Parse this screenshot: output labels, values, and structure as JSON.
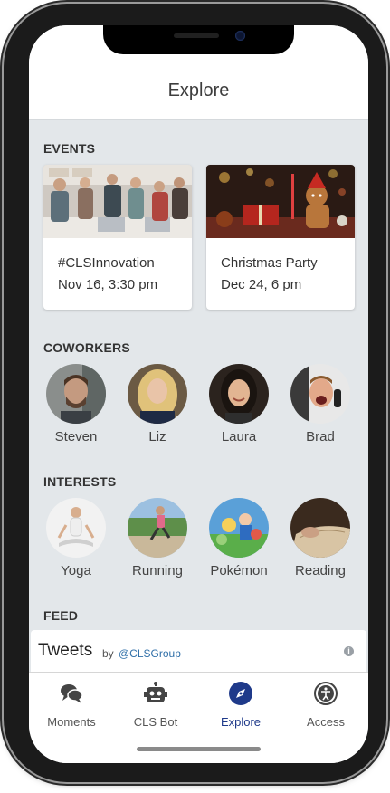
{
  "header": {
    "title": "Explore"
  },
  "events": {
    "section_title": "EVENTS",
    "items": [
      {
        "title": "#CLSInnovation",
        "date": "Nov 16, 3:30 pm"
      },
      {
        "title": "Christmas Party",
        "date": "Dec 24, 6 pm"
      }
    ]
  },
  "coworkers": {
    "section_title": "COWORKERS",
    "items": [
      {
        "name": "Steven"
      },
      {
        "name": "Liz"
      },
      {
        "name": "Laura"
      },
      {
        "name": "Brad"
      }
    ]
  },
  "interests": {
    "section_title": "INTERESTS",
    "items": [
      {
        "name": "Yoga"
      },
      {
        "name": "Running"
      },
      {
        "name": "Pokémon"
      },
      {
        "name": "Reading"
      }
    ]
  },
  "feed": {
    "section_title": "FEED",
    "tweets_label": "Tweets",
    "by_label": "by",
    "handle": "@CLSGroup"
  },
  "tabbar": {
    "items": [
      {
        "label": "Moments",
        "icon": "chat-bubbles-icon"
      },
      {
        "label": "CLS Bot",
        "icon": "robot-icon"
      },
      {
        "label": "Explore",
        "icon": "compass-icon",
        "active": true
      },
      {
        "label": "Access",
        "icon": "accessibility-icon"
      }
    ],
    "active_color": "#1f3a8a"
  }
}
